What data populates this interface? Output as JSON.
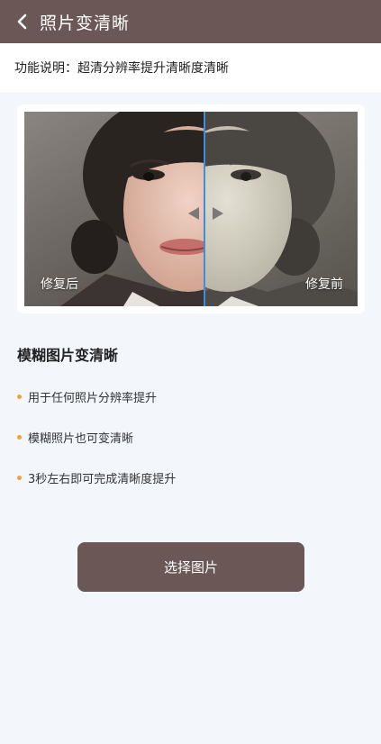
{
  "header": {
    "title": "照片变清晰",
    "back_icon": "chevron-left-icon"
  },
  "description": {
    "text": "功能说明：超清分辨率提升清晰度清晰"
  },
  "preview": {
    "after_label": "修复后",
    "before_label": "修复前",
    "handle_icon": "left-right-arrows-icon"
  },
  "section": {
    "title": "模糊图片变清晰",
    "features": [
      "用于任何照片分辨率提升",
      "模糊照片也可变清晰",
      "3秒左右即可完成清晰度提升"
    ]
  },
  "actions": {
    "select_label": "选择图片"
  },
  "colors": {
    "brand": "#6b5856",
    "accent": "#f0a23a",
    "divider": "#3b8fe0",
    "background": "#f3f6fb"
  }
}
